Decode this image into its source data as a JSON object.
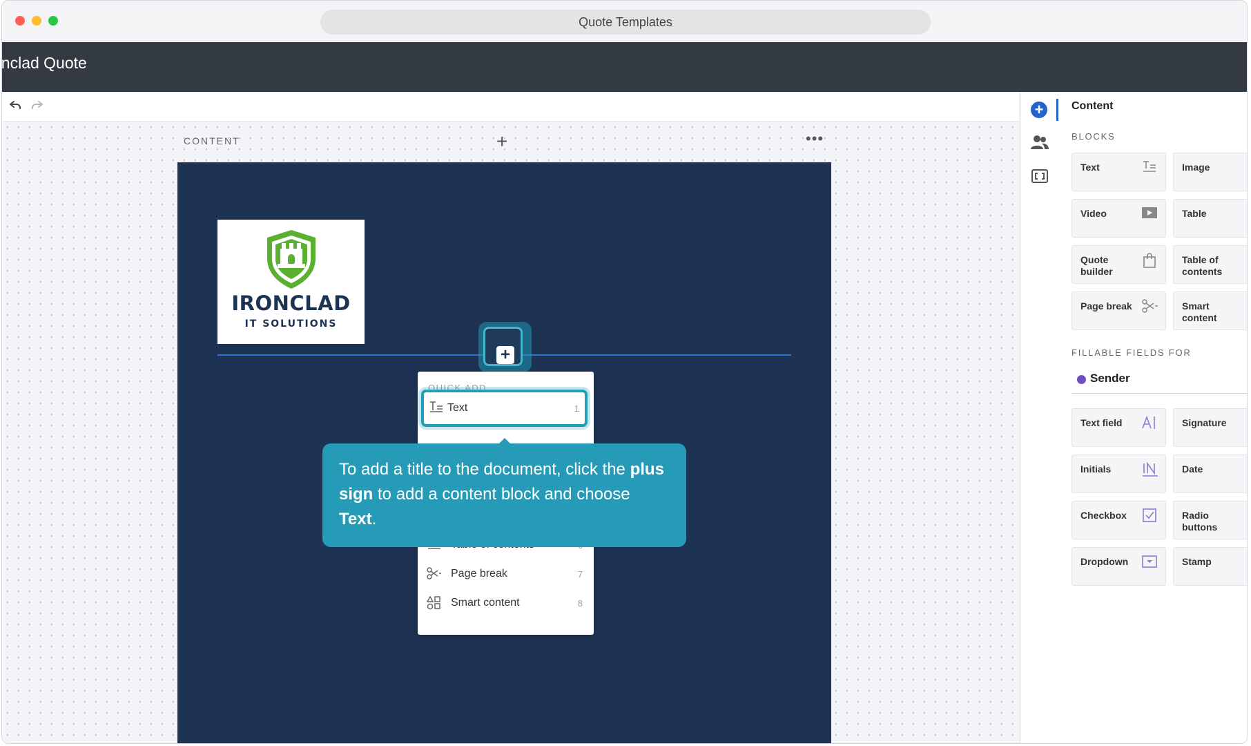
{
  "window": {
    "url_title": "Quote Templates"
  },
  "app": {
    "title": "onclad Quote"
  },
  "toolbar": {
    "undo_icon": "undo-icon",
    "redo_icon": "redo-icon"
  },
  "section": {
    "label": "CONTENT",
    "add_icon": "plus-icon",
    "more_icon": "more-icon"
  },
  "logo": {
    "name": "IRONCLAD",
    "subtitle": "IT SOLUTIONS",
    "brand_color": "#5bb031"
  },
  "quick_add": {
    "header": "QUICK ADD",
    "items": [
      {
        "label": "Text",
        "num": "1",
        "icon": "text-icon"
      },
      {
        "label": "Table of contents",
        "num": "6",
        "icon": "list-icon"
      },
      {
        "label": "Page break",
        "num": "7",
        "icon": "scissors-icon"
      },
      {
        "label": "Smart content",
        "num": "8",
        "icon": "shapes-icon"
      }
    ]
  },
  "tooltip": {
    "part1": "To add a title to the document, click the ",
    "bold1": "plus sign",
    "part2": " to add a content block and choose ",
    "bold2": "Text",
    "part3": "."
  },
  "sidebar": {
    "title": "Content",
    "blocks_header": "BLOCKS",
    "blocks": [
      {
        "label": "Text",
        "icon": "text-icon"
      },
      {
        "label": "Image",
        "icon": "image-icon"
      },
      {
        "label": "Video",
        "icon": "video-icon"
      },
      {
        "label": "Table",
        "icon": "table-icon"
      },
      {
        "label": "Quote builder",
        "icon": "bag-icon"
      },
      {
        "label": "Table of contents",
        "icon": "list-icon"
      },
      {
        "label": "Page break",
        "icon": "scissors-icon"
      },
      {
        "label": "Smart content",
        "icon": "shapes-icon"
      }
    ],
    "fields_header": "FILLABLE FIELDS FOR",
    "sender": "Sender",
    "fields": [
      {
        "label": "Text field",
        "icon": "text-field-icon"
      },
      {
        "label": "Signature",
        "icon": "signature-icon"
      },
      {
        "label": "Initials",
        "icon": "initials-icon"
      },
      {
        "label": "Date",
        "icon": "calendar-icon"
      },
      {
        "label": "Checkbox",
        "icon": "checkbox-icon"
      },
      {
        "label": "Radio buttons",
        "icon": "radio-icon"
      },
      {
        "label": "Dropdown",
        "icon": "dropdown-icon"
      },
      {
        "label": "Stamp",
        "icon": "stamp-icon"
      }
    ]
  },
  "colors": {
    "accent": "#2563c9",
    "tooltip": "#259bb7",
    "page_bg": "#1e3353",
    "header_bg": "#343a42"
  }
}
